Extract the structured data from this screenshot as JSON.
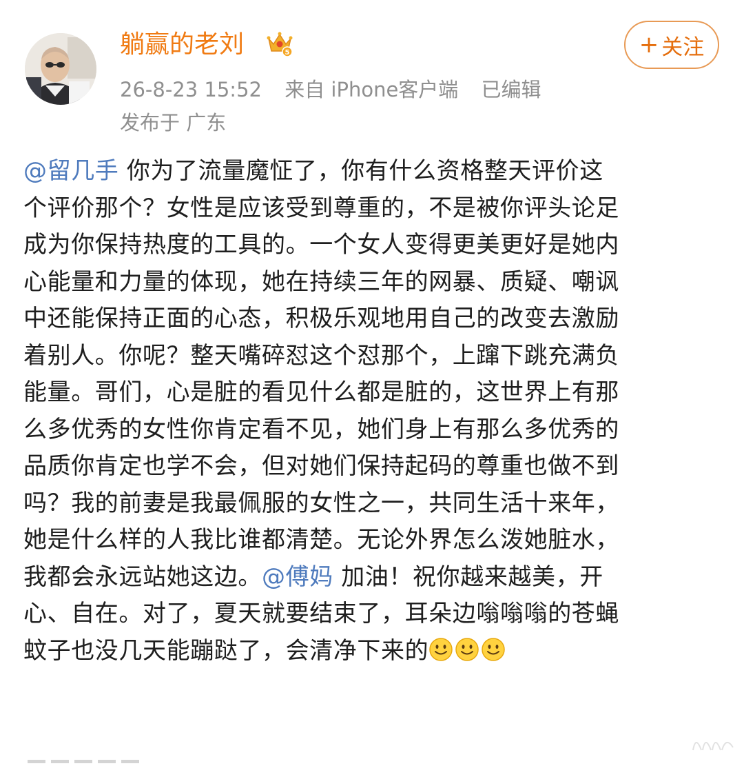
{
  "post": {
    "author": {
      "name": "躺赢的老刘",
      "badge_icon": "vip-crown-icon",
      "badge_color": "#f3a21e"
    },
    "timestamp": "26-8-23 15:52",
    "source": "来自 iPhone客户端",
    "edited": "已编辑",
    "location": "发布于 广东",
    "follow_button": {
      "plus": "+",
      "label": "关注"
    },
    "body": {
      "line1": {
        "mention": "@留几手",
        "text": " 你为了流量魔怔了，你有什么资格整天评价这"
      },
      "line2": "个评价那个？女性是应该受到尊重的，不是被你评头论足",
      "line3": "成为你保持热度的工具的。一个女人变得更美更好是她内",
      "line4": "心能量和力量的体现，她在持续三年的网暴、质疑、嘲讽",
      "line5": "中还能保持正面的心态，积极乐观地用自己的改变去激励",
      "line6": "着别人。你呢？整天嘴碎怼这个怼那个，上蹿下跳充满负",
      "line7": "能量。哥们，心是脏的看见什么都是脏的，这世界上有那",
      "line8": "么多优秀的女性你肯定看不见，她们身上有那么多优秀的",
      "line9": "品质你肯定也学不会，但对她们保持起码的尊重也做不到",
      "line10": "吗？我的前妻是我最佩服的女性之一，共同生活十来年，",
      "line11": "她是什么样的人我比谁都清楚。无论外界怎么泼她脏水，",
      "line12": {
        "before": "我都会永远站她这边。",
        "mention": "@傅妈",
        "after": " 加油！祝你越来越美，开"
      },
      "line13": "心、自在。对了，夏天就要结束了，耳朵边嗡嗡嗡的苍蝇",
      "line14": {
        "text": "蚊子也没几天能蹦跶了，会清净下来的",
        "emoji": [
          "smile-emoji-icon",
          "smile-emoji-icon",
          "smile-emoji-icon"
        ]
      }
    },
    "colors": {
      "username": "#f07b13",
      "mention": "#4f7bbd",
      "meta": "#8f8f8f",
      "follow_border": "#e89a55"
    }
  }
}
